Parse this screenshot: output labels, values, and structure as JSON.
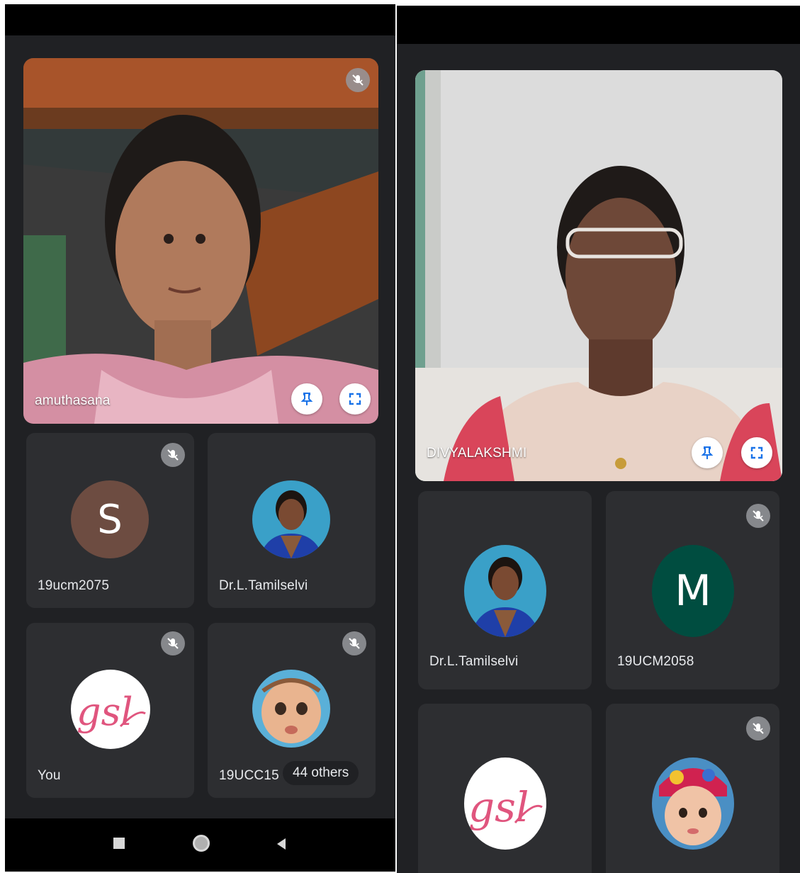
{
  "left": {
    "main_video": {
      "name": "amuthasana"
    },
    "tiles": [
      {
        "name": "19ucm2075",
        "avatar_letter": "S",
        "avatar_color": "#6d4c41"
      },
      {
        "name": "Dr.L.Tamilselvi"
      },
      {
        "name": "You"
      },
      {
        "name": "19UCC15"
      }
    ],
    "others_label": "44 others"
  },
  "right": {
    "main_video": {
      "name": "DIVYALAKSHMI"
    },
    "tiles": [
      {
        "name": "Dr.L.Tamilselvi"
      },
      {
        "name": "19UCM2058",
        "avatar_letter": "M",
        "avatar_color": "#004d40"
      }
    ]
  },
  "colors": {
    "background": "#202124",
    "tile": "#2d2e31",
    "accent": "#1a73e8"
  },
  "icons": [
    "mic-off-icon",
    "pin-icon",
    "fullscreen-icon",
    "nav-square-icon",
    "nav-home-icon",
    "nav-back-icon"
  ]
}
